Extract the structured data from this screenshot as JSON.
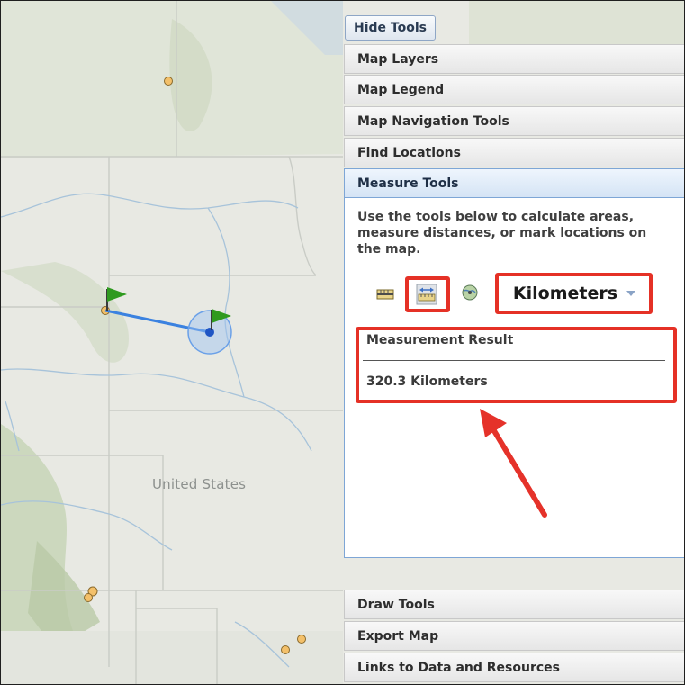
{
  "map": {
    "country_label": "United States"
  },
  "toolbar": {
    "hide_tools_label": "Hide Tools"
  },
  "accordion": {
    "items": [
      {
        "label": "Map Layers"
      },
      {
        "label": "Map Legend"
      },
      {
        "label": "Map Navigation Tools"
      },
      {
        "label": "Find Locations"
      },
      {
        "label": "Measure Tools"
      },
      {
        "label": "Draw Tools"
      },
      {
        "label": "Export Map"
      },
      {
        "label": "Links to Data and Resources"
      }
    ],
    "active_index": 4
  },
  "measure": {
    "description": "Use the tools below to calculate areas, measure distances, or mark locations on the map.",
    "tools": [
      {
        "icon": "area-ruler-icon",
        "selected": false
      },
      {
        "icon": "distance-ruler-icon",
        "selected": true
      },
      {
        "icon": "location-globe-icon",
        "selected": false
      }
    ],
    "unit_selected": "Kilometers",
    "result_title": "Measurement Result",
    "result_value": "320.3 Kilometers"
  },
  "colors": {
    "highlight_red": "#e53126",
    "measure_line_blue": "#3b82e0",
    "flag_green": "#2f9a1f",
    "marker_orange": "#f3c06a"
  }
}
